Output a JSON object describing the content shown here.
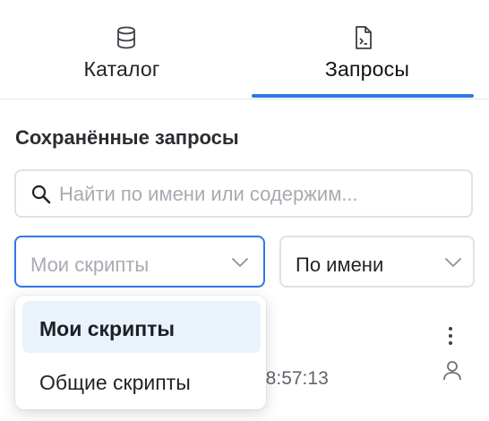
{
  "tabs": [
    {
      "label": "Каталог",
      "icon": "database-icon",
      "active": false
    },
    {
      "label": "Запросы",
      "icon": "script-file-icon",
      "active": true
    }
  ],
  "section_title": "Сохранённые запросы",
  "search": {
    "placeholder": "Найти по имени или содержим...",
    "value": "",
    "icon": "search-icon"
  },
  "scripts_filter": {
    "value": "Мои скрипты",
    "icon": "chevron-down-icon"
  },
  "sort_select": {
    "value": "По имени",
    "icon": "chevron-down-icon"
  },
  "dropdown": {
    "options": [
      {
        "label": "Мои скрипты",
        "selected": true
      },
      {
        "label": "Общие скрипты",
        "selected": false
      }
    ]
  },
  "list": {
    "visible_time": "08:57:13",
    "menu_icon": "kebab-menu-icon",
    "owner_icon": "user-icon"
  },
  "colors": {
    "accent": "#2f78e6",
    "selected_bg": "#eaf2fc",
    "placeholder": "#a7abb1",
    "border": "#dfe1e5"
  }
}
